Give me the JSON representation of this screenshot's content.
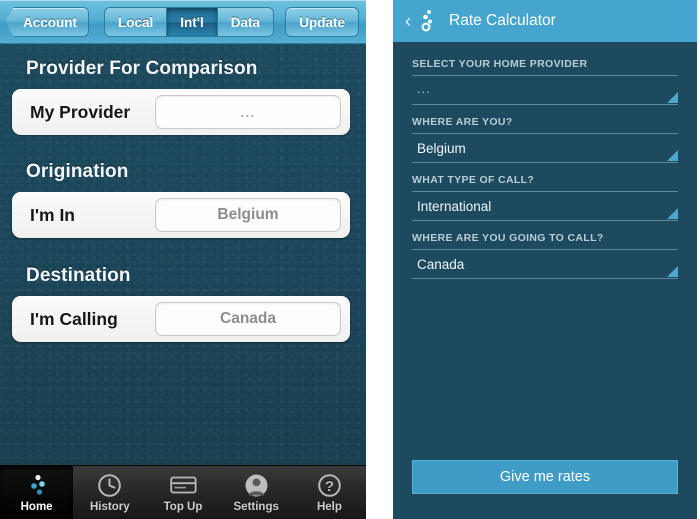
{
  "left_phone": {
    "navbar": {
      "back_label": "Account",
      "segments": [
        {
          "label": "Local",
          "active": false
        },
        {
          "label": "Int'l",
          "active": true
        },
        {
          "label": "Data",
          "active": false
        }
      ],
      "update_label": "Update"
    },
    "sections": [
      {
        "heading": "Provider For Comparison",
        "row_label": "My Provider",
        "row_value": "...",
        "is_placeholder": true
      },
      {
        "heading": "Origination",
        "row_label": "I'm In",
        "row_value": "Belgium",
        "is_placeholder": false
      },
      {
        "heading": "Destination",
        "row_label": "I'm Calling",
        "row_value": "Canada",
        "is_placeholder": false
      }
    ],
    "tabbar": [
      {
        "label": "Home",
        "icon": "dots-logo-icon",
        "selected": true
      },
      {
        "label": "History",
        "icon": "clock-icon",
        "selected": false
      },
      {
        "label": "Top Up",
        "icon": "credit-card-icon",
        "selected": false
      },
      {
        "label": "Settings",
        "icon": "person-icon",
        "selected": false
      },
      {
        "label": "Help",
        "icon": "question-mark-icon",
        "selected": false
      }
    ]
  },
  "right_phone": {
    "appbar": {
      "back_icon": "chevron-left-icon",
      "logo_icon": "dots-logo-icon",
      "title": "Rate Calculator"
    },
    "fields": [
      {
        "label": "SELECT YOUR HOME PROVIDER",
        "value": "...",
        "is_placeholder": true
      },
      {
        "label": "WHERE ARE YOU?",
        "value": "Belgium",
        "is_placeholder": false
      },
      {
        "label": "WHAT TYPE OF CALL?",
        "value": "International",
        "is_placeholder": false
      },
      {
        "label": "WHERE ARE YOU GOING TO CALL?",
        "value": "Canada",
        "is_placeholder": false
      }
    ],
    "submit_label": "Give me rates"
  },
  "colors": {
    "ios_nav_blue": "#57b0d4",
    "deep_teal": "#1d4a5e",
    "android_blue": "#45a5ce",
    "accent_caret": "#4ea7cf",
    "button_blue": "#3f9cc6",
    "tabbar_dark": "#2a2a2a"
  }
}
